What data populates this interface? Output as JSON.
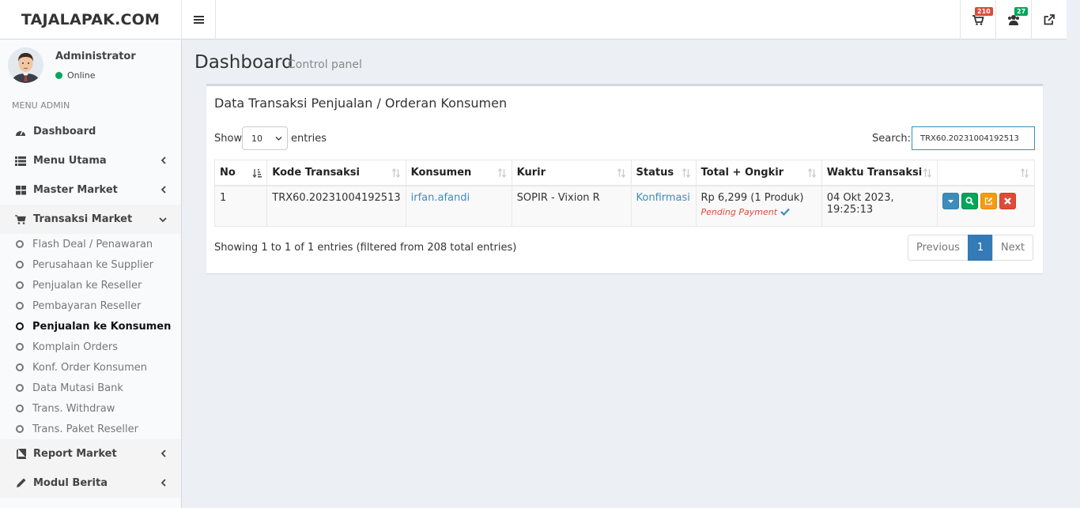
{
  "header": {
    "logo": "TAJALAPAK.COM",
    "cart_badge": "210",
    "users_badge": "27",
    "icons": [
      "bars-icon",
      "cart-icon",
      "users-icon",
      "external-link-icon"
    ]
  },
  "sidebar": {
    "user_name": "Administrator",
    "user_status": "Online",
    "menu_header": "MENU ADMIN",
    "items": [
      {
        "label": "Dashboard",
        "icon": "dashboard-icon"
      },
      {
        "label": "Menu Utama",
        "icon": "list-icon"
      },
      {
        "label": "Master Market",
        "icon": "grid-icon"
      },
      {
        "label": "Transaksi Market",
        "icon": "cart-icon"
      },
      {
        "label": "Report Market",
        "icon": "book-icon"
      },
      {
        "label": "Modul Berita",
        "icon": "pencil-icon"
      }
    ],
    "sub_items": [
      "Flash Deal / Penawaran",
      "Perusahaan ke Supplier",
      "Penjualan ke Reseller",
      "Pembayaran Reseller",
      "Penjualan ke Konsumen",
      "Komplain Orders",
      "Konf. Order Konsumen",
      "Data Mutasi Bank",
      "Trans. Withdraw",
      "Trans. Paket Reseller"
    ]
  },
  "page": {
    "title": "Dashboard",
    "subtitle": "Control panel"
  },
  "box": {
    "title": "Data Transaksi Penjualan / Orderan Konsumen",
    "show_label": "Show",
    "length_value": "10",
    "entries_label": "entries",
    "search_label": "Search:",
    "search_value": "TRX60.20231004192513",
    "columns": [
      "No",
      "Kode Transaksi",
      "Konsumen",
      "Kurir",
      "Status",
      "Total + Ongkir",
      "Waktu Transaksi",
      ""
    ],
    "rows": [
      {
        "no": "1",
        "kode": "TRX60.20231004192513",
        "konsumen": "irfan.afandi",
        "kurir": "SOPIR - Vixion R",
        "status": "Konfirmasi",
        "total": "Rp 6,299 (1 Produk)",
        "payment": "Pending Payment",
        "waktu": "04 Okt 2023, 19:25:13"
      }
    ],
    "info": "Showing 1 to 1 of 1 entries (filtered from 208 total entries)",
    "pager": {
      "previous": "Previous",
      "current": "1",
      "next": "Next"
    }
  },
  "colors": {
    "primary": "#3c8dbc",
    "success": "#00a65a",
    "warning": "#f39c12",
    "danger": "#dd4b39",
    "page_active": "#337ab7"
  }
}
